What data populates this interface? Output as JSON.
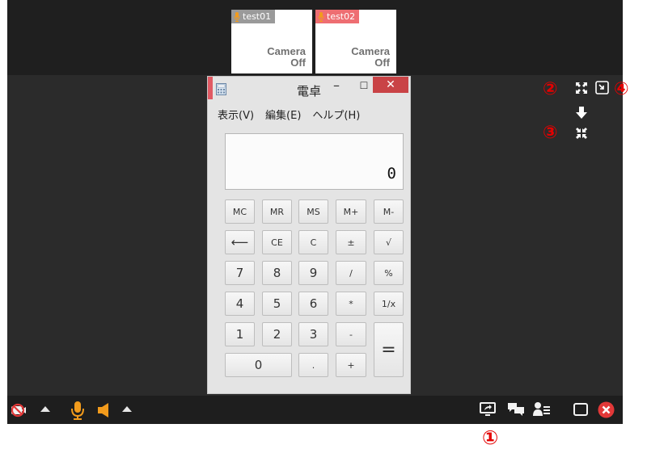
{
  "participants": [
    {
      "name": "test01",
      "status_line1": "Camera",
      "status_line2": "Off",
      "label_color": "#9a9a9a"
    },
    {
      "name": "test02",
      "status_line1": "Camera",
      "status_line2": "Off",
      "label_color": "#ee6e72"
    }
  ],
  "calculator": {
    "title": "電卓",
    "menu": [
      "表示(V)",
      "編集(E)",
      "ヘルプ(H)"
    ],
    "display": "0",
    "keys": {
      "mc": "MC",
      "mr": "MR",
      "ms": "MS",
      "mplus": "M+",
      "mminus": "M-",
      "back": "⟵",
      "ce": "CE",
      "c": "C",
      "plusminus": "±",
      "sqrt": "√",
      "k7": "7",
      "k8": "8",
      "k9": "9",
      "div": "/",
      "pct": "%",
      "k4": "4",
      "k5": "5",
      "k6": "6",
      "mul": "*",
      "inv": "1/x",
      "k1": "1",
      "k2": "2",
      "k3": "3",
      "sub": "-",
      "eq": "=",
      "k0": "0",
      "dot": ".",
      "add": "+"
    }
  },
  "annotations": {
    "a1": "①",
    "a2": "②",
    "a3": "③",
    "a4": "④"
  },
  "colors": {
    "accent_orange": "#f29b1c",
    "annotation_red": "#e40000",
    "close_red": "#e23838"
  }
}
